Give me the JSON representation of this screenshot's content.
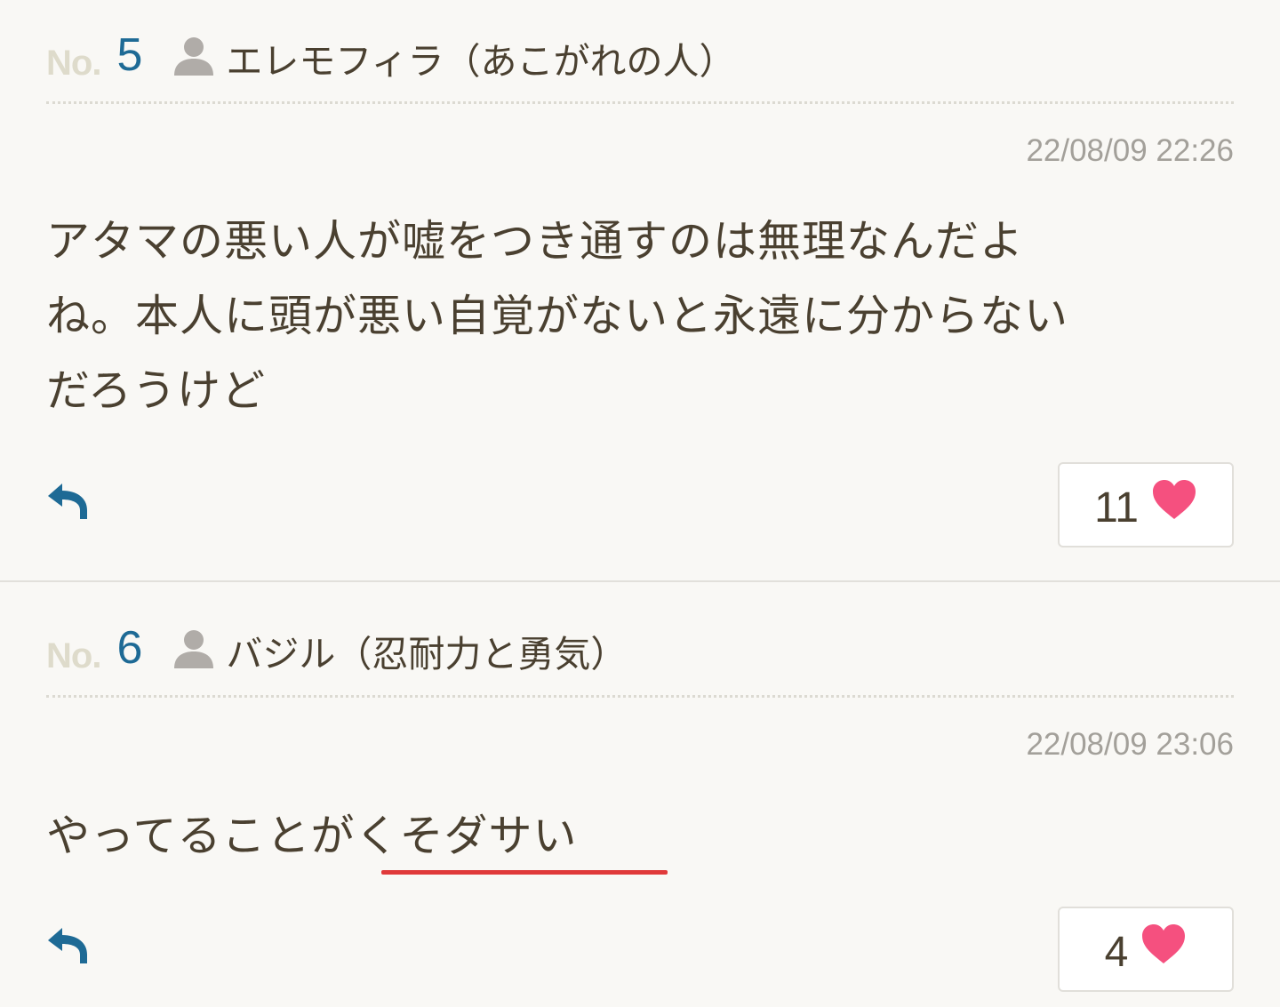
{
  "colors": {
    "background": "#f9f8f5",
    "text": "#4a4030",
    "no_label": "#dedbcb",
    "no_number": "#1e6a95",
    "icon_gray": "#b0aca8",
    "timestamp": "#a3a09a",
    "heart": "#f5507f",
    "reply": "#1e6a95",
    "underline": "#e03a3a"
  },
  "comments": [
    {
      "no_label": "No.",
      "number": "5",
      "user_icon": "user-icon",
      "user_name": "エレモフィラ（あこがれの人）",
      "timestamp": "22/08/09 22:26",
      "body_lines": [
        "アタマの悪い人が嘘をつき通すのは無理なんだよ",
        "ね。本人に頭が悪い自覚がないと永遠に分からない",
        "だろうけど"
      ],
      "reply_icon": "reply-icon",
      "like_count": "11",
      "like_icon": "heart-icon"
    },
    {
      "no_label": "No.",
      "number": "6",
      "user_icon": "user-icon",
      "user_name": "バジル（忍耐力と勇気）",
      "timestamp": "22/08/09 23:06",
      "body_lines": [
        "やってることがくそダサい"
      ],
      "reply_icon": "reply-icon",
      "like_count": "4",
      "like_icon": "heart-icon"
    }
  ]
}
